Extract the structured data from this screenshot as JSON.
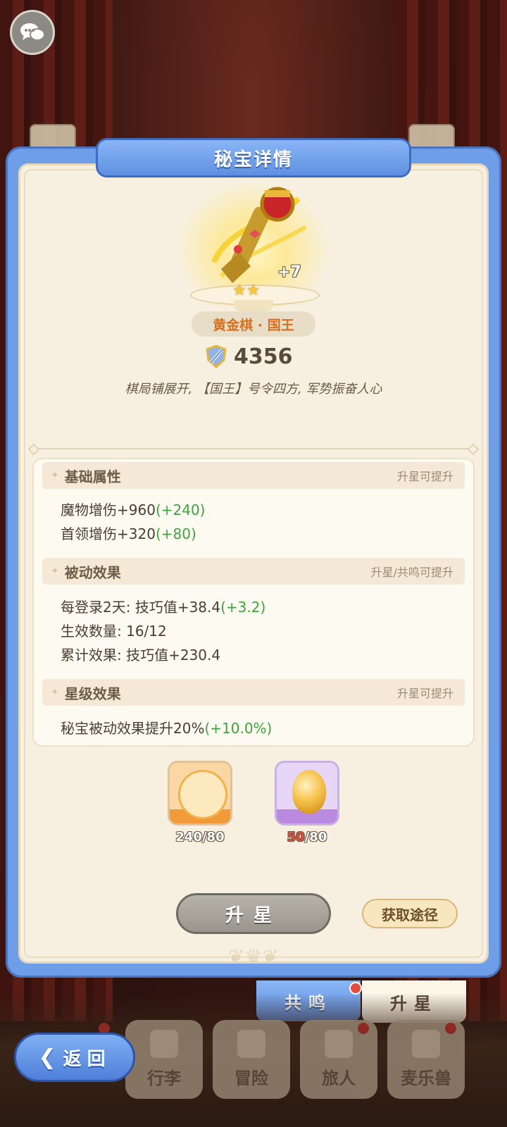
{
  "dialog": {
    "title": "秘宝详情"
  },
  "treasure": {
    "name": "黄金棋 · 国王",
    "level": "+7",
    "stars": "★★",
    "power": "4356",
    "description": "棋局铺展开, 【国王】号令四方, 军势振奋人心"
  },
  "sections": {
    "basic": {
      "title": "基础属性",
      "hint": "升星可提升",
      "lines": [
        {
          "text": "魔物增伤+960",
          "bonus": "(+240)"
        },
        {
          "text": "首领增伤+320",
          "bonus": "(+80)"
        }
      ]
    },
    "passive": {
      "title": "被动效果",
      "hint": "升星/共鸣可提升",
      "lines": [
        {
          "text": "每登录2天: 技巧值+38.4",
          "bonus": "(+3.2)"
        },
        {
          "text": "生效数量: 16/12",
          "bonus": ""
        },
        {
          "text": "累计效果: 技巧值+230.4",
          "bonus": ""
        }
      ]
    },
    "star": {
      "title": "星级效果",
      "hint": "升星可提升",
      "lines": [
        {
          "text": "秘宝被动效果提升20%",
          "bonus": "(+10.0%)"
        }
      ]
    }
  },
  "materials": [
    {
      "have": "240",
      "need": "/80",
      "icon": "scepter-shard-icon"
    },
    {
      "have": "50",
      "need": "/80",
      "icon": "golden-egg-icon"
    }
  ],
  "buttons": {
    "upgrade_star": "升星",
    "get_source": "获取途径"
  },
  "tabs": {
    "resonance": "共鸣",
    "star": "升星"
  },
  "nav": {
    "back": "返回",
    "items": [
      "行李",
      "冒险",
      "旅人",
      "麦乐兽"
    ]
  },
  "colors": {
    "accent_blue": "#5f8fe0",
    "bonus_green": "#3ea33e",
    "name_orange": "#d7701d",
    "lack_red": "#e54b3b"
  }
}
